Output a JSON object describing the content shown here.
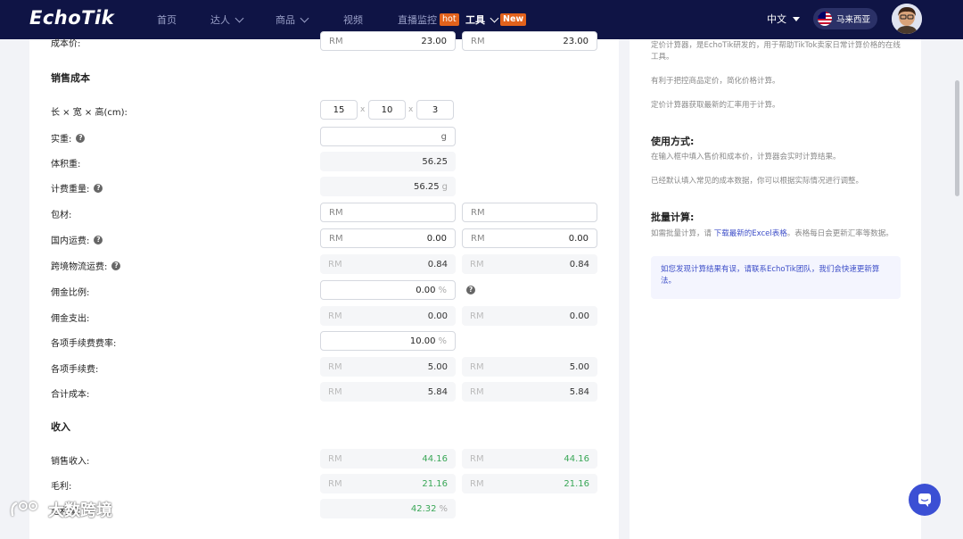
{
  "nav": {
    "logo": "EchoTik",
    "items": [
      {
        "label": "首页"
      },
      {
        "label": "达人"
      },
      {
        "label": "商品"
      },
      {
        "label": "视频"
      },
      {
        "label": "直播监控",
        "badge": "hot"
      },
      {
        "label": "工具",
        "badge": "New"
      }
    ],
    "language": "中文",
    "region": "马来西亚"
  },
  "calc": {
    "cost_row": {
      "label": "成本价:",
      "prefix": "RM",
      "value1": "23.00",
      "value2": "23.00"
    },
    "section_sales_cost": "销售成本",
    "dimensions": {
      "label": "长 × 宽 × 高(cm):",
      "length": "15",
      "width": "10",
      "height": "3",
      "sep": "x"
    },
    "actual_weight": {
      "label": "实重:",
      "unit": "g"
    },
    "volume_weight": {
      "label": "体积重:",
      "value": "56.25"
    },
    "billing_weight": {
      "label": "计费重量:",
      "value": "56.25",
      "unit": "g"
    },
    "packaging": {
      "label": "包材:",
      "prefix": "RM"
    },
    "domestic_shipping": {
      "label": "国内运费:",
      "prefix": "RM",
      "value1": "0.00",
      "value2": "0.00"
    },
    "cross_border": {
      "label": "跨境物流运费:",
      "prefix": "RM",
      "value1": "0.84",
      "value2": "0.84"
    },
    "commission_rate": {
      "label": "佣金比例:",
      "value": "0.00",
      "unit": "%"
    },
    "commission_expense": {
      "label": "佣金支出:",
      "prefix": "RM",
      "value1": "0.00",
      "value2": "0.00"
    },
    "fee_rate": {
      "label": "各项手续费费率:",
      "value": "10.00",
      "unit": "%"
    },
    "fees": {
      "label": "各项手续费:",
      "prefix": "RM",
      "value1": "5.00",
      "value2": "5.00"
    },
    "total_cost": {
      "label": "合计成本:",
      "prefix": "RM",
      "value1": "5.84",
      "value2": "5.84"
    },
    "section_income": "收入",
    "sales_income": {
      "label": "销售收入:",
      "prefix": "RM",
      "value1": "44.16",
      "value2": "44.16"
    },
    "gross_profit": {
      "label": "毛利:",
      "prefix": "RM",
      "value1": "21.16",
      "value2": "21.16"
    },
    "margin": {
      "label": "毛利率:",
      "value": "42.32",
      "unit": "%"
    }
  },
  "side": {
    "intro1": "定价计算器，是EchoTik研发的，用于帮助TikTok卖家日常计算价格的在线工具。",
    "intro2": "有利于把控商品定价，简化价格计算。",
    "intro3": "定价计算器获取最新的汇率用于计算。",
    "usage_title": "使用方式:",
    "usage1": "在输入框中填入售价和成本价，计算器会实时计算结果。",
    "usage2": "已经默认填入常见的成本数据，你可以根据实际情况进行调整。",
    "batch_title": "批量计算:",
    "batch_pre": "如需批量计算，请 ",
    "batch_link": "下载最新的Excel表格",
    "batch_post": "。表格每日会更新汇率等数据。",
    "notice": "如您发现计算结果有误，请联系EchoTik团队，我们会快速更新算法。"
  },
  "watermark": "大数跨境",
  "colors": {
    "nav_bg": "#0f1445",
    "accent": "#3d4ec8",
    "badge": "#e2621c",
    "positive": "#3aa757"
  }
}
